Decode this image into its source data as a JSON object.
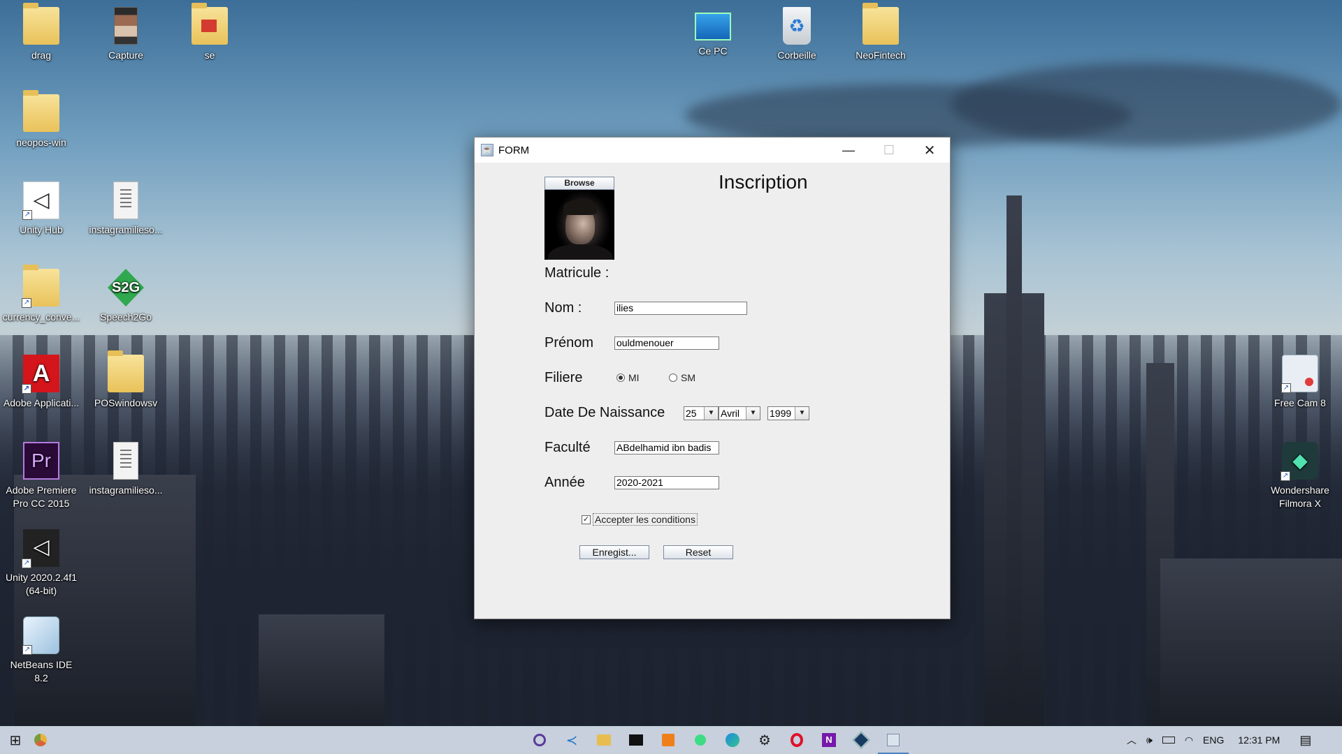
{
  "desktop": {
    "icons_left": [
      {
        "label": "drag",
        "icon": "folder-icon"
      },
      {
        "label": "Capture",
        "icon": "image-file-icon"
      },
      {
        "label": "se",
        "icon": "pdf-folder-icon"
      },
      {
        "label": "neopos-win",
        "icon": "folder-icon"
      },
      {
        "label": "Unity Hub",
        "icon": "unity-hub-icon"
      },
      {
        "label": "instagramilieso...",
        "icon": "text-file-icon"
      },
      {
        "label": "currency_conve...",
        "icon": "folder-icon"
      },
      {
        "label": "Speech2Go",
        "icon": "speech2go-icon",
        "badge": "S2G"
      },
      {
        "label": "Adobe Applicati...",
        "icon": "adobe-icon"
      },
      {
        "label": "POSwindowsv",
        "icon": "folder-icon"
      },
      {
        "label": "Adobe Premiere Pro CC 2015",
        "icon": "premiere-icon",
        "badge": "Pr"
      },
      {
        "label": "instagramilieso...",
        "icon": "text-file-icon"
      },
      {
        "label": "Unity 2020.2.4f1 (64-bit)",
        "icon": "unity-icon"
      },
      {
        "label": "NetBeans IDE 8.2",
        "icon": "netbeans-icon"
      }
    ],
    "icons_top": [
      {
        "label": "Ce PC",
        "icon": "computer-icon"
      },
      {
        "label": "Corbeille",
        "icon": "recycle-bin-icon"
      },
      {
        "label": "NeoFintech",
        "icon": "folder-icon"
      }
    ],
    "icons_right": [
      {
        "label": "Free Cam 8",
        "icon": "free-cam-icon"
      },
      {
        "label": "Wondershare Filmora X",
        "icon": "filmora-icon"
      }
    ]
  },
  "window": {
    "title": "FORM",
    "controls": {
      "minimize": "—",
      "maximize": "☐",
      "close": "✕"
    },
    "form": {
      "heading": "Inscription",
      "browse_label": "Browse",
      "matricule_label": "Matricule :",
      "nom_label": "Nom :",
      "nom_value": "ilies",
      "prenom_label": "Prénom",
      "prenom_value": "ouldmenouer",
      "filiere_label": "Filiere",
      "filiere_options": [
        "MI",
        "SM"
      ],
      "filiere_selected": "MI",
      "dob_label": "Date De Naissance",
      "dob_day": "25",
      "dob_month": "Avril",
      "dob_year": "1999",
      "faculte_label": "Faculté",
      "faculte_value": "ABdelhamid ibn badis",
      "annee_label": "Année",
      "annee_value": "2020-2021",
      "accept_label": "Accepter les conditions",
      "accept_checked": true,
      "save_label": "Enregist...",
      "reset_label": "Reset"
    }
  },
  "taskbar": {
    "apps": [
      "start-icon",
      "chrome-canary-icon",
      "obs-icon",
      "vscode-icon",
      "file-explorer-icon",
      "terminal-icon",
      "sublime-icon",
      "android-studio-icon",
      "edge-icon",
      "settings-icon",
      "opera-icon",
      "onenote-icon",
      "virtualbox-icon",
      "java-app-icon"
    ],
    "language": "ENG",
    "time": "12:31 PM"
  }
}
